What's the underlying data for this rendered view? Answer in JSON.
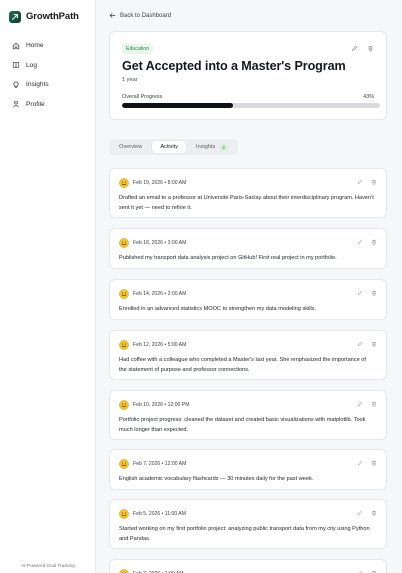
{
  "app": {
    "name": "GrowthPath",
    "footer": "AI-Powered Goal Tracking"
  },
  "colors": {
    "accent": "#1f6f54",
    "progress": "#0f1216",
    "tag_bg": "#e8f6ec",
    "tag_fg": "#2c8a4c"
  },
  "sidebar": {
    "items": [
      {
        "label": "Home",
        "icon": "home-icon"
      },
      {
        "label": "Log",
        "icon": "book-icon"
      },
      {
        "label": "Insights",
        "icon": "lightbulb-icon"
      },
      {
        "label": "Profile",
        "icon": "user-icon"
      }
    ]
  },
  "header": {
    "back_label": "Back to Dashboard"
  },
  "goal": {
    "category": "Education",
    "title": "Get Accepted into a Master's Program",
    "duration": "1 year",
    "progress_label": "Overall Progress",
    "progress_text": "43%",
    "progress_value": 0.43
  },
  "tabs": [
    {
      "label": "Overview"
    },
    {
      "label": "Activity",
      "active": true
    },
    {
      "label": "Insights",
      "badge": "2"
    }
  ],
  "entries": [
    {
      "date": "Feb 19, 2026 • 8:00 AM",
      "text": "Drafted an email to a professor at Université Paris-Saclay about their interdisciplinary program. Haven't sent it yet — need to refine it."
    },
    {
      "date": "Feb 18, 2026 • 3:00 AM",
      "text": "Published my transport data analysis project on GitHub! First real project in my portfolio."
    },
    {
      "date": "Feb 14, 2026 • 2:00 AM",
      "text": "Enrolled in an advanced statistics MOOC to strengthen my data modeling skills."
    },
    {
      "date": "Feb 12, 2026 • 5:00 AM",
      "text": "Had coffee with a colleague who completed a Master's last year. She emphasized the importance of the statement of purpose and professor connections."
    },
    {
      "date": "Feb 10, 2026 • 12:00 PM",
      "text": "Portfolio project progress: cleaned the dataset and created basic visualizations with matplotlib. Took much longer than expected."
    },
    {
      "date": "Feb 7, 2026 • 12:00 AM",
      "text": "English academic vocabulary flashcards — 30 minutes daily for the past week."
    },
    {
      "date": "Feb 5, 2026 • 11:00 AM",
      "text": "Started working on my first portfolio project: analyzing public transport data from my city using Python and Pandas."
    },
    {
      "date": "Feb 3, 2026 • 1:00 AM",
      "text": ""
    }
  ]
}
